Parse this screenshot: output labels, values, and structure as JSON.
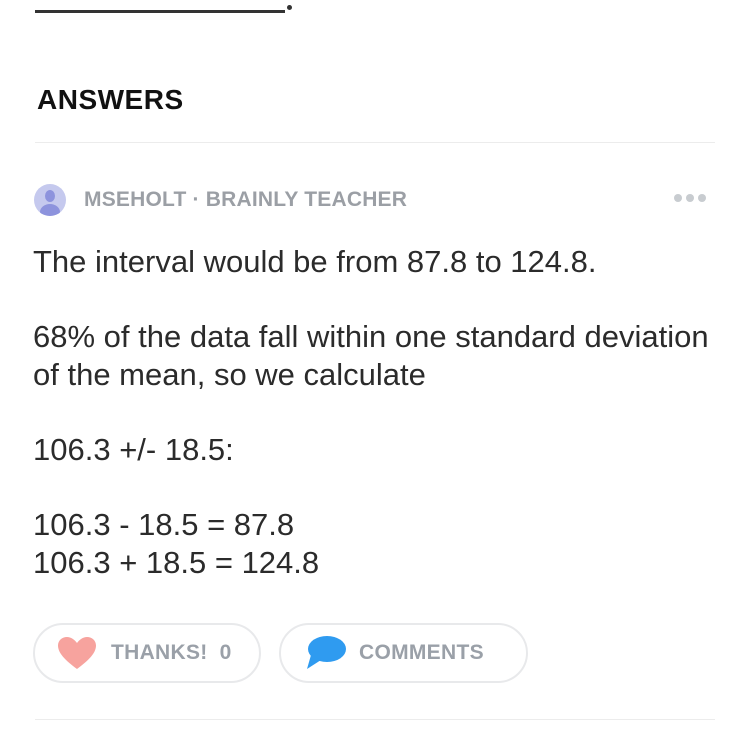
{
  "section": {
    "title": "ANSWERS"
  },
  "answer": {
    "author": "MSEHOLT · BRAINLY TEACHER",
    "paragraphs": [
      "The interval would be from 87.8 to 124.8.",
      "68% of the data fall within one standard deviation of the mean, so we calculate",
      "106.3 +/- 18.5:",
      "106.3 - 18.5 = 87.8",
      "106.3 + 18.5 = 124.8"
    ]
  },
  "actions": {
    "thanks_label": "THANKS!",
    "thanks_count": "0",
    "comments_label": "COMMENTS"
  },
  "icons": {
    "avatar": "user-avatar-icon",
    "more": "more-options-icon",
    "heart": "heart-icon",
    "comment": "comment-bubble-icon"
  },
  "colors": {
    "heart": "#f7a39e",
    "comment": "#2f9bf0",
    "muted_text": "#9aa0a8",
    "avatar": "#8d93dd"
  }
}
